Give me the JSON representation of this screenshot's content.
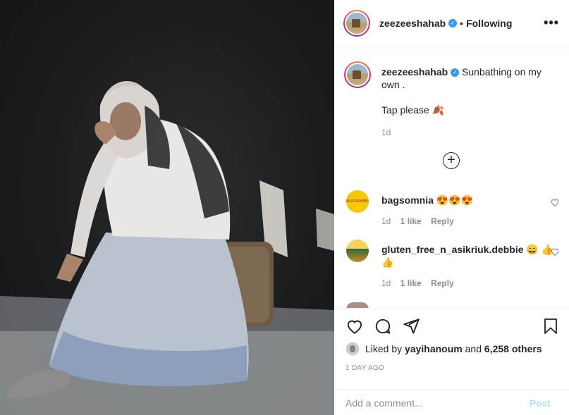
{
  "header": {
    "username": "zeezeeshahab",
    "verified_icon": "verified-badge-icon",
    "separator": "•",
    "following_label": "Following",
    "more_icon": "•••"
  },
  "caption": {
    "username": "zeezeeshahab",
    "text": "Sunbathing on my own .",
    "line2": "Tap please 🍂",
    "age": "1d"
  },
  "load_more": {
    "icon": "+"
  },
  "comments": [
    {
      "username": "bagsomnia",
      "text": "😍😍😍",
      "avatar_text": "BAGSOMNIA",
      "age": "1d",
      "likes": "1 like",
      "reply": "Reply"
    },
    {
      "username": "gluten_free_n_asikriuk.debbie",
      "text": "😄 👍👍",
      "age": "1d",
      "likes": "1 like",
      "reply": "Reply"
    }
  ],
  "likes": {
    "prefix": "Liked by",
    "user": "yayihanoum",
    "and": "and",
    "others": "6,258 others"
  },
  "date": "1 DAY AGO",
  "add_comment": {
    "placeholder": "Add a comment...",
    "post_label": "Post"
  },
  "colors": {
    "verified": "#3897f0",
    "post_disabled": "#b2dffc",
    "meta": "#8e8e8e",
    "divider": "#efefef"
  }
}
